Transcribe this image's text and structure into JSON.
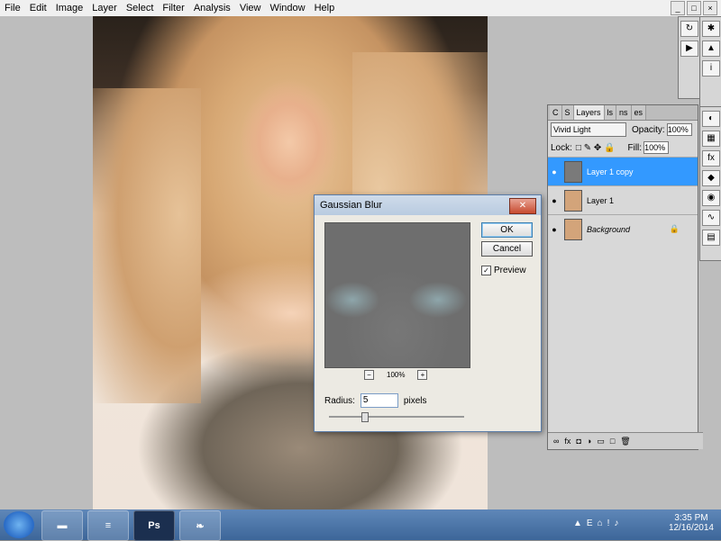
{
  "menu": [
    "File",
    "Edit",
    "Image",
    "Layer",
    "Select",
    "Filter",
    "Analysis",
    "View",
    "Window",
    "Help"
  ],
  "window_controls": [
    "_",
    "□",
    "×"
  ],
  "layers_panel": {
    "tabs": [
      "C",
      "S",
      "Layers",
      "ls",
      "ns",
      "es"
    ],
    "blend_mode": "Vivid Light",
    "opacity_label": "Opacity:",
    "opacity_value": "100%",
    "lock_label": "Lock:",
    "fill_label": "Fill:",
    "fill_value": "100%",
    "layers": [
      {
        "name": "Layer 1 copy",
        "selected": true
      },
      {
        "name": "Layer 1",
        "selected": false
      },
      {
        "name": "Background",
        "selected": false
      }
    ],
    "bottom_icons": [
      "link-icon",
      "fx-icon",
      "mask-icon",
      "adjustment-icon",
      "group-icon",
      "new-layer-icon",
      "delete-icon"
    ]
  },
  "dialog": {
    "title": "Gaussian Blur",
    "ok_label": "OK",
    "cancel_label": "Cancel",
    "preview_label": "Preview",
    "preview_checked": true,
    "zoom": "100%",
    "radius_label": "Radius:",
    "radius_value": "5",
    "radius_unit": "pixels"
  },
  "taskbar": {
    "apps": [
      "folder-icon",
      "stack-icon",
      "Ps",
      "leaf-icon"
    ],
    "time": "3:35 PM",
    "date": "12/16/2014"
  }
}
